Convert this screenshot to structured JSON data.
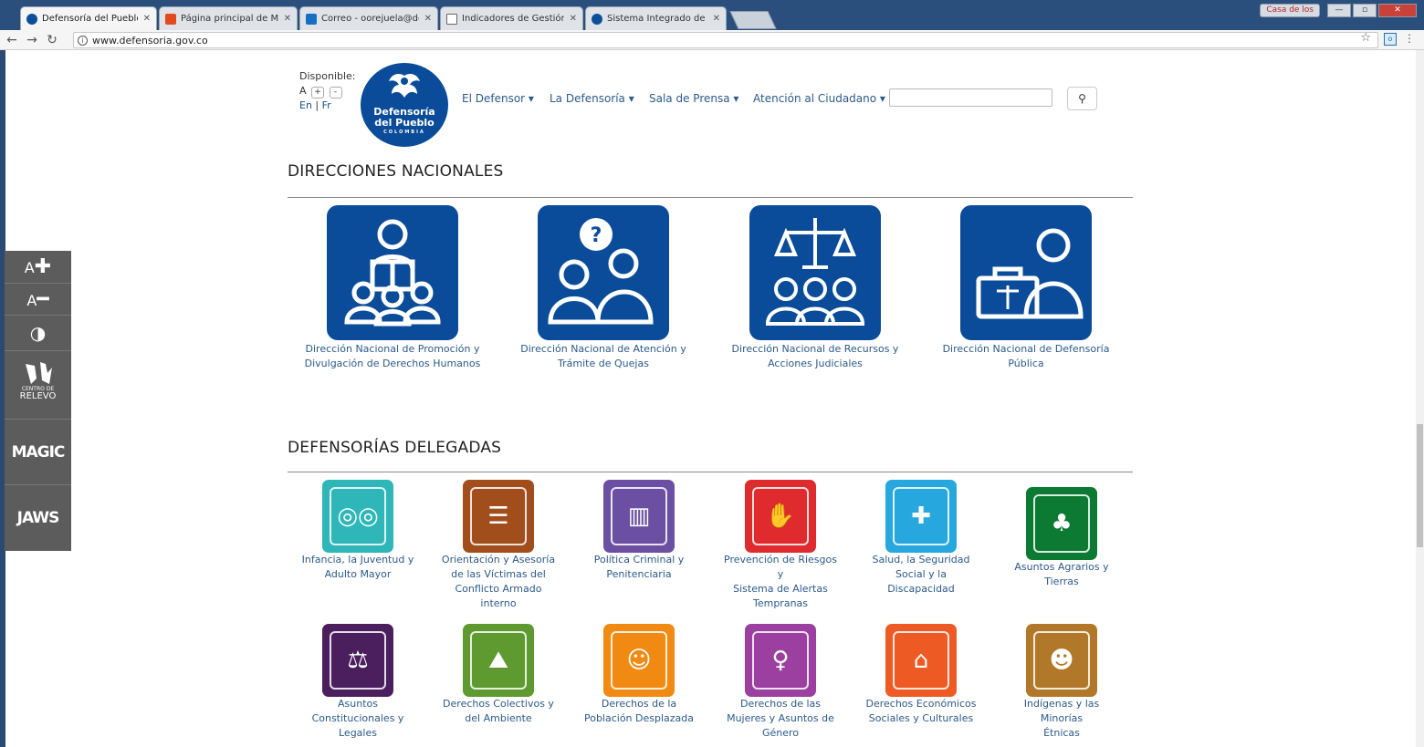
{
  "browser": {
    "tabs": [
      {
        "title": "Defensoría del Pueblo",
        "icon": "defensoria-favicon",
        "active": true
      },
      {
        "title": "Página principal de Micr",
        "icon": "office-icon"
      },
      {
        "title": "Correo - oorejuela@defe",
        "icon": "outlook-icon"
      },
      {
        "title": "Indicadores de Gestión -",
        "icon": "document-icon"
      },
      {
        "title": "Sistema Integrado de Ge",
        "icon": "defensoria-favicon"
      }
    ],
    "casa_label": "Casa de los",
    "url": "www.defensoria.gov.co"
  },
  "accessibility_bar": {
    "increase_label": "A",
    "decrease_label": "A",
    "relevo_label_1": "CENTRO DE",
    "relevo_label_2": "RELEVO",
    "magic_label": "MAGIC",
    "jaws_label": "JAWS"
  },
  "header": {
    "disponible": "Disponible:",
    "font_a": "A",
    "font_plus": "+",
    "font_minus": "-",
    "lang_en": "En",
    "lang_sep": "|",
    "lang_fr": "Fr",
    "logo_line1": "Defensoría",
    "logo_line2": "del Pueblo",
    "logo_line3": "COLOMBIA",
    "nav": [
      "El Defensor ▾",
      "La Defensoría ▾",
      "Sala de Prensa ▾",
      "Atención al Ciudadano ▾"
    ]
  },
  "direcciones": {
    "title": "DIRECCIONES NACIONALES",
    "items": [
      {
        "line1": "Dirección Nacional de Promoción y",
        "line2": "Divulgación de Derechos Humanos"
      },
      {
        "line1": "Dirección Nacional de Atención y",
        "line2": "Trámite de Quejas"
      },
      {
        "line1": "Dirección Nacional de Recursos y",
        "line2": "Acciones Judiciales"
      },
      {
        "line1": "Dirección Nacional de Defensoría",
        "line2": "Pública"
      }
    ]
  },
  "delegadas": {
    "title": "DEFENSORÍAS DELEGADAS",
    "row1": [
      {
        "lines": [
          "Infancia, la Juventud y",
          "Adulto Mayor"
        ],
        "color": "#2fb6b8"
      },
      {
        "lines": [
          "Orientación y Asesoría",
          "de las Víctimas del",
          "Conflicto Armado",
          "interno"
        ],
        "color": "#a14e1c"
      },
      {
        "lines": [
          "Política Criminal y",
          "Penitenciaria"
        ],
        "color": "#6a4fa3"
      },
      {
        "lines": [
          "Prevención de Riesgos y",
          "Sistema de Alertas",
          "Tempranas"
        ],
        "color": "#e02b2e"
      },
      {
        "lines": [
          "Salud, la Seguridad",
          "Social y la Discapacidad"
        ],
        "color": "#26a8df"
      },
      {
        "lines": [
          "Asuntos Agrarios y",
          "Tierras"
        ],
        "color": "#0c7a33"
      }
    ],
    "row2": [
      {
        "lines": [
          "Asuntos",
          "Constitucionales y",
          "Legales"
        ],
        "color": "#4b1f5e"
      },
      {
        "lines": [
          "Derechos Colectivos y",
          "del Ambiente"
        ],
        "color": "#5e9a2f"
      },
      {
        "lines": [
          "Derechos de la",
          "Población Desplazada"
        ],
        "color": "#f08a12"
      },
      {
        "lines": [
          "Derechos de las",
          "Mujeres y Asuntos de",
          "Género"
        ],
        "color": "#9b3fa0"
      },
      {
        "lines": [
          "Derechos Económicos",
          "Sociales y Culturales"
        ],
        "color": "#ee5a24"
      },
      {
        "lines": [
          "Indígenas y las Minorías",
          "Étnicas"
        ],
        "color": "#b2782a"
      }
    ]
  }
}
